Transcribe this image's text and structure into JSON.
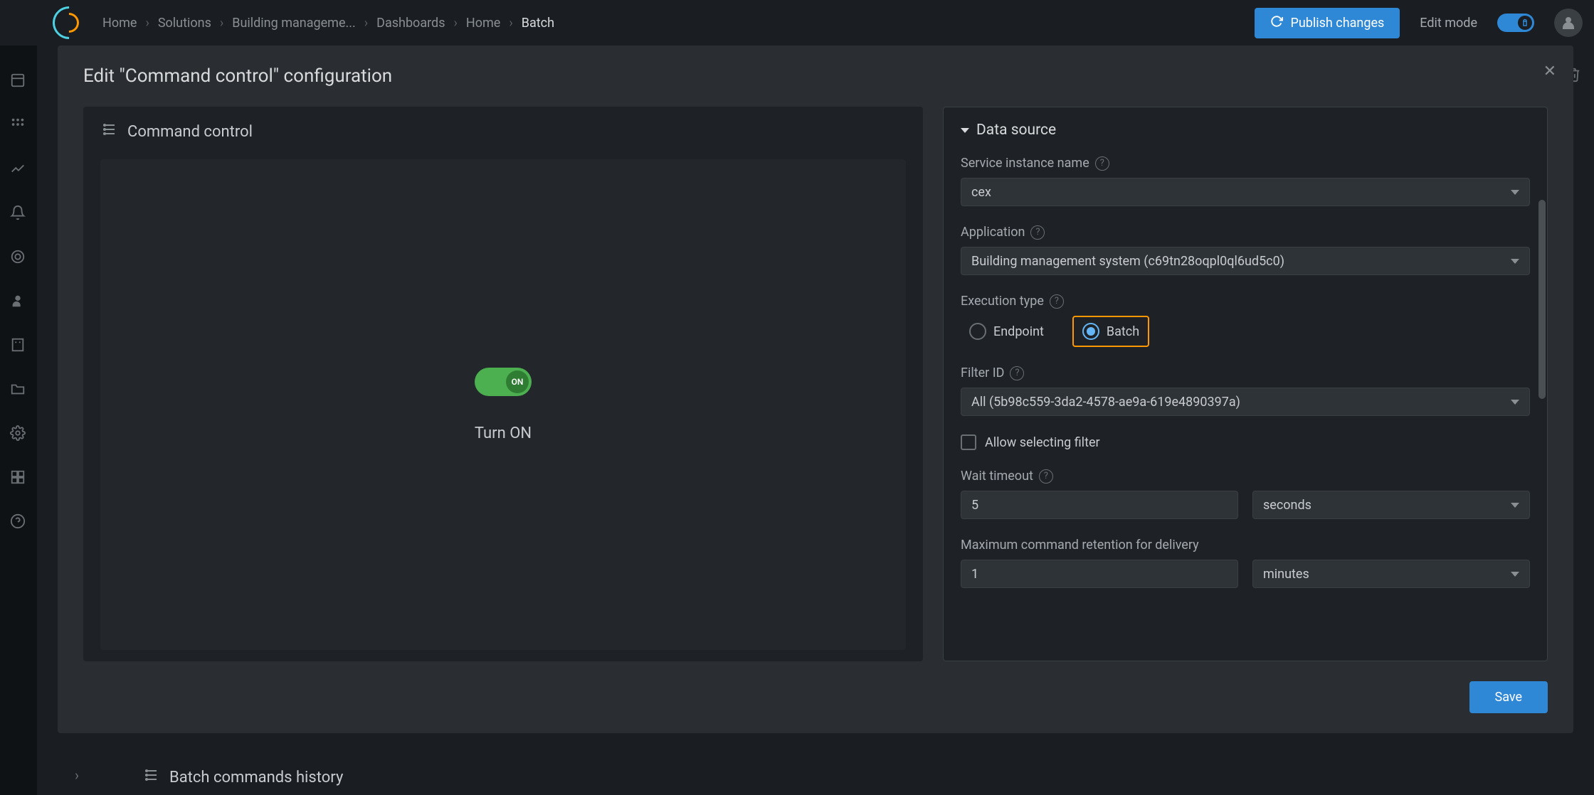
{
  "breadcrumbs": {
    "items": [
      "Home",
      "Solutions",
      "Building manageme...",
      "Dashboards",
      "Home",
      "Batch"
    ]
  },
  "header": {
    "publish_label": "Publish changes",
    "edit_mode_label": "Edit mode"
  },
  "modal": {
    "title": "Edit \"Command control\" configuration",
    "close_glyph": "✕",
    "save_label": "Save"
  },
  "preview": {
    "title": "Command control",
    "toggle_state": "ON",
    "action_label": "Turn ON"
  },
  "config": {
    "section_title": "Data source",
    "service_instance": {
      "label": "Service instance name",
      "value": "cex"
    },
    "application": {
      "label": "Application",
      "value": "Building management system (c69tn28oqpl0ql6ud5c0)"
    },
    "execution_type": {
      "label": "Execution type",
      "options": [
        "Endpoint",
        "Batch"
      ],
      "selected": "Batch"
    },
    "filter_id": {
      "label": "Filter ID",
      "value": "All (5b98c559-3da2-4578-ae9a-619e4890397a)"
    },
    "allow_filter": {
      "label": "Allow selecting filter",
      "checked": false
    },
    "wait_timeout": {
      "label": "Wait timeout",
      "value": "5",
      "unit": "seconds"
    },
    "max_retention": {
      "label": "Maximum command retention for delivery",
      "value": "1",
      "unit": "minutes"
    }
  },
  "below_section": {
    "title": "Batch commands history"
  }
}
